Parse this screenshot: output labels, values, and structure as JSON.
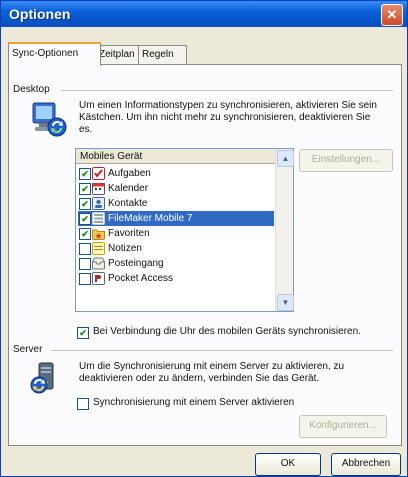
{
  "window": {
    "title": "Optionen",
    "close_label": "✕"
  },
  "tabs": [
    "Sync-Optionen",
    "Zeitplan",
    "Regeln"
  ],
  "desktop": {
    "group_label": "Desktop",
    "description": "Um einen Informationstypen zu synchronisieren, aktivieren Sie sein Kästchen. Um ihn nicht mehr zu synchronisieren, deaktivieren Sie es.",
    "list_header": "Mobiles Gerät",
    "items": [
      {
        "label": "Aufgaben",
        "checked": true,
        "icon": "tasks-icon"
      },
      {
        "label": "Kalender",
        "checked": true,
        "icon": "calendar-icon"
      },
      {
        "label": "Kontakte",
        "checked": true,
        "icon": "contacts-icon"
      },
      {
        "label": "FileMaker Mobile 7",
        "checked": true,
        "icon": "filemaker-icon",
        "selected": true
      },
      {
        "label": "Favoriten",
        "checked": true,
        "icon": "favorites-folder-icon"
      },
      {
        "label": "Notizen",
        "checked": false,
        "icon": "notes-icon"
      },
      {
        "label": "Posteingang",
        "checked": false,
        "icon": "inbox-icon"
      },
      {
        "label": "Pocket Access",
        "checked": false,
        "icon": "pocket-access-icon"
      }
    ],
    "settings_button": "Einstellungen...",
    "sync_clock_label": "Bei Verbindung die Uhr des mobilen Geräts synchronisieren.",
    "sync_clock_checked": true
  },
  "server": {
    "group_label": "Server",
    "description": "Um die Synchronisierung mit einem Server zu aktivieren, zu deaktivieren oder zu ändern, verbinden Sie das Gerät.",
    "enable_label": "Synchronisierung mit einem Server aktivieren",
    "enable_checked": false,
    "configure_button": "Konfigurieren..."
  },
  "footer": {
    "ok_label": "OK",
    "cancel_label": "Abbrechen"
  }
}
